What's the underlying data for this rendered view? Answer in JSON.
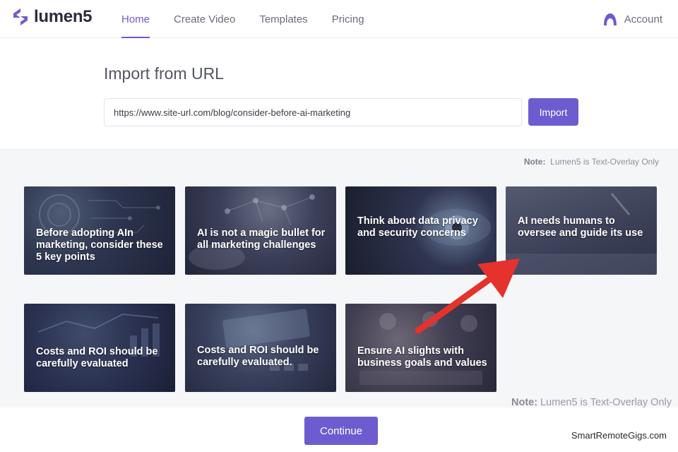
{
  "header": {
    "logo_text": "lumen5",
    "nav": [
      {
        "label": "Home",
        "active": true
      },
      {
        "label": "Create Video",
        "active": false
      },
      {
        "label": "Templates",
        "active": false
      },
      {
        "label": "Pricing",
        "active": false
      }
    ],
    "account_label": "Account",
    "account_icon": "user-avatar-icon"
  },
  "import": {
    "title": "Import from URL",
    "url_value": "https://www.site-url.com/blog/consider-before-ai-marketing",
    "button_label": "Import"
  },
  "note_top": {
    "label": "Note:",
    "text": "Lumen5 is Text-Overlay Only"
  },
  "cards": [
    {
      "text": "Before adopting AIn marketing, consider these 5 key points"
    },
    {
      "text": "AI is not a magic bullet for all marketing challenges"
    },
    {
      "text": "Think about data privacy and security concerns"
    },
    {
      "text": "AI needs humans to oversee and guide its use"
    },
    {
      "text": "Costs and ROI should be carefully evaluated"
    },
    {
      "text": "Costs and ROI should be carefully evaluated."
    },
    {
      "text": "Ensure AI slights with business goals and values"
    }
  ],
  "note_bottom": {
    "label": "Note:",
    "text": "Lumen5 is Text-Overlay Only"
  },
  "footer": {
    "continue_label": "Continue",
    "watermark": "SmartRemoteGigs.com"
  },
  "colors": {
    "accent": "#6d5ccf",
    "arrow": "#e5322d"
  }
}
